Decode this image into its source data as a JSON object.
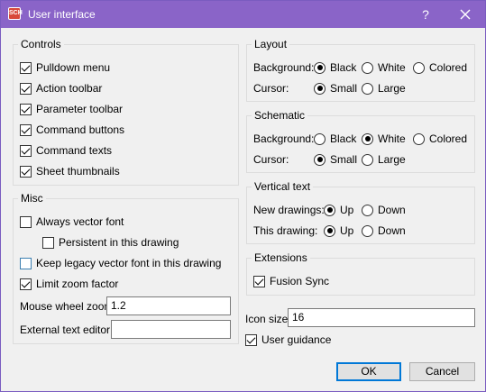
{
  "window": {
    "title": "User interface",
    "help_glyph": "?",
    "app_icon_text": "SCH"
  },
  "controls": {
    "legend": "Controls",
    "items": [
      {
        "label": "Pulldown menu",
        "checked": true
      },
      {
        "label": "Action toolbar",
        "checked": true
      },
      {
        "label": "Parameter toolbar",
        "checked": true
      },
      {
        "label": "Command buttons",
        "checked": true
      },
      {
        "label": "Command texts",
        "checked": true
      },
      {
        "label": "Sheet thumbnails",
        "checked": true
      }
    ]
  },
  "misc": {
    "legend": "Misc",
    "always_vector_font": {
      "label": "Always vector font",
      "checked": false
    },
    "persistent": {
      "label": "Persistent in this drawing",
      "checked": false
    },
    "keep_legacy": {
      "label": "Keep legacy vector font in this drawing",
      "checked": false
    },
    "limit_zoom": {
      "label": "Limit zoom factor",
      "checked": true
    },
    "mouse_wheel_zoom": {
      "label": "Mouse wheel zoom",
      "value": "1.2"
    },
    "external_editor": {
      "label": "External text editor",
      "value": ""
    }
  },
  "layout": {
    "legend": "Layout",
    "background_label": "Background:",
    "background_options": [
      "Black",
      "White",
      "Colored"
    ],
    "background_selected": "Black",
    "cursor_label": "Cursor:",
    "cursor_options": [
      "Small",
      "Large"
    ],
    "cursor_selected": "Small"
  },
  "schematic": {
    "legend": "Schematic",
    "background_label": "Background:",
    "background_options": [
      "Black",
      "White",
      "Colored"
    ],
    "background_selected": "White",
    "cursor_label": "Cursor:",
    "cursor_options": [
      "Small",
      "Large"
    ],
    "cursor_selected": "Small"
  },
  "vertical_text": {
    "legend": "Vertical text",
    "new_label": "New drawings:",
    "this_label": "This drawing:",
    "options": [
      "Up",
      "Down"
    ],
    "new_selected": "Up",
    "this_selected": "Up"
  },
  "extensions": {
    "legend": "Extensions",
    "fusion_sync": {
      "label": "Fusion Sync",
      "checked": true
    }
  },
  "icon_size": {
    "label": "Icon size",
    "value": "16"
  },
  "user_guidance": {
    "label": "User guidance",
    "checked": true
  },
  "buttons": {
    "ok": "OK",
    "cancel": "Cancel"
  }
}
